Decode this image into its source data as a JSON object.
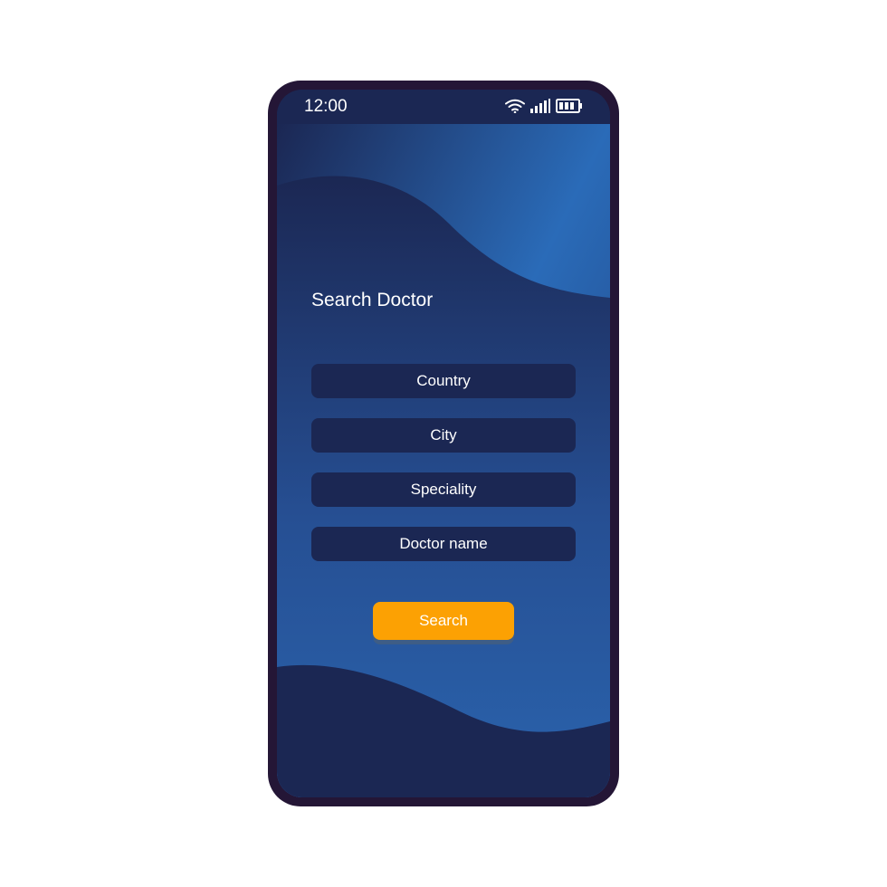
{
  "status_bar": {
    "time": "12:00",
    "icons": [
      "wifi-icon",
      "signal-icon",
      "battery-icon"
    ]
  },
  "page": {
    "title": "Search Doctor"
  },
  "form": {
    "fields": [
      {
        "label": "Country"
      },
      {
        "label": "City"
      },
      {
        "label": "Speciality"
      },
      {
        "label": "Doctor name"
      }
    ],
    "search_label": "Search"
  },
  "colors": {
    "frame": "#241636",
    "background_dark": "#1b2753",
    "background_light": "#2a6bb8",
    "accent": "#fca103",
    "text": "#ffffff"
  }
}
